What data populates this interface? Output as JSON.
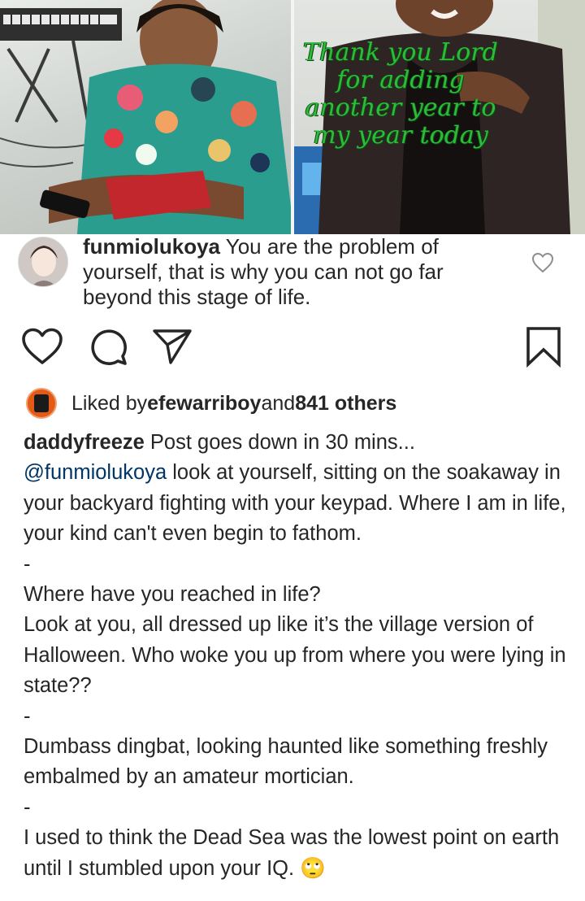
{
  "post_image": {
    "overlay_text": "Thank you Lord for adding another year to my year today"
  },
  "comment": {
    "username": "funmiolukoya",
    "text": " You are the problem of yourself, that is why you can not go far beyond this stage of life."
  },
  "likes": {
    "prefix": "Liked by ",
    "user": "efewarriboy",
    "joiner": " and ",
    "others": "841 others"
  },
  "caption": {
    "username": "daddyfreeze",
    "first_line": " Post goes down in 30 mins...",
    "mention": "@funmiolukoya",
    "p1": " look at yourself, sitting on the soakaway in your backyard fighting with your keypad. Where I am in life, your kind can't even begin to fathom.",
    "sep1": "-",
    "p2": "Where have you reached in life?",
    "p3": "Look at you, all dressed up like it’s the village version of Halloween. Who woke you up from where you were lying in state??",
    "sep2": "-",
    "p4": "Dumbass dingbat, looking haunted like something freshly embalmed by an amateur mortician.",
    "sep3": "-",
    "p5": "I used to think the Dead Sea was the lowest point on earth until I stumbled upon your IQ. 🙄"
  },
  "icons": {
    "like": "heart-icon",
    "comment": "comment-bubble-icon",
    "share": "paper-plane-icon",
    "save": "bookmark-icon",
    "comment_like": "small-heart-icon"
  }
}
